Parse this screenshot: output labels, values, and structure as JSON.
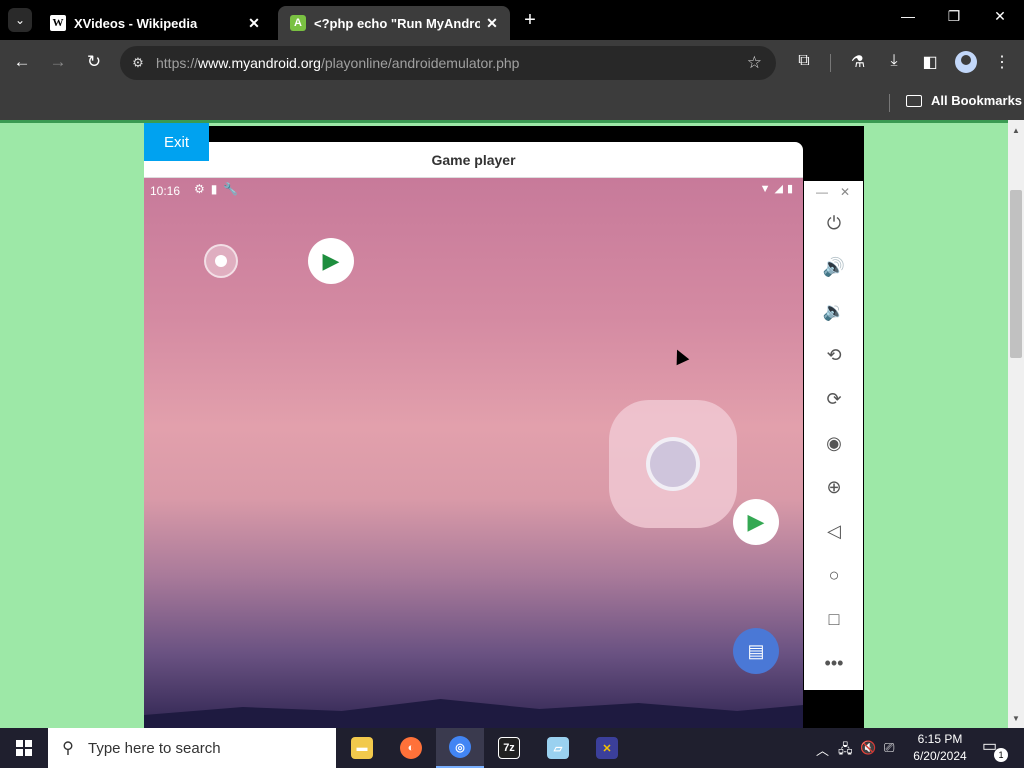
{
  "browser": {
    "tabs": [
      {
        "title": "XVideos - Wikipedia",
        "favicon": "W"
      },
      {
        "title": "<?php echo \"Run MyAndroid\"",
        "favicon": "A"
      }
    ],
    "url_scheme": "https://",
    "url_host": "www.myandroid.org",
    "url_path": "/playonline/androidemulator.php",
    "bookmarks_label": "All Bookmarks"
  },
  "page": {
    "exit_label": "Exit",
    "panel_title": "Game player",
    "background_color": "#9de8a7"
  },
  "emulator": {
    "time": "10:16",
    "sidebar_buttons": [
      "power-icon",
      "volume-up-icon",
      "volume-down-icon",
      "rotate-left-icon",
      "rotate-right-icon",
      "camera-icon",
      "zoom-icon",
      "back-icon",
      "home-icon",
      "overview-icon",
      "more-icon"
    ]
  },
  "taskbar": {
    "search_placeholder": "Type here to search",
    "time": "6:15 PM",
    "date": "6/20/2024",
    "notification_count": "1",
    "sevenzip_label": "7z"
  }
}
